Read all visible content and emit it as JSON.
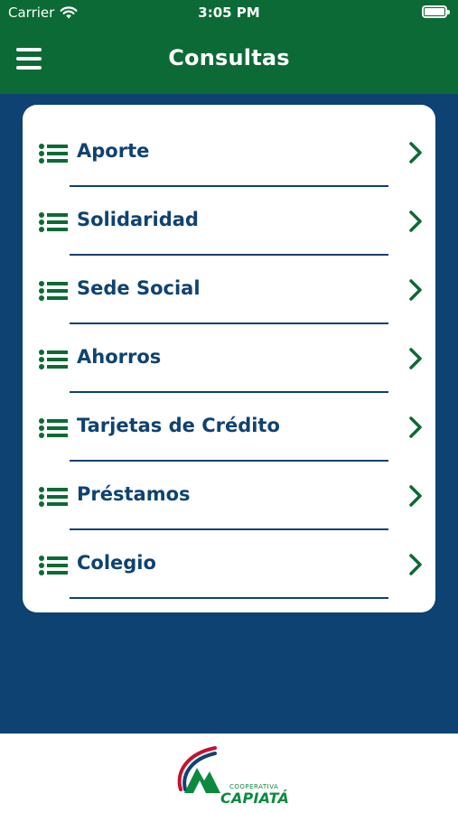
{
  "status_bar": {
    "carrier": "Carrier",
    "time": "3:05 PM",
    "wifi_icon": "wifi-icon",
    "battery_icon": "battery-icon"
  },
  "header": {
    "title": "Consultas",
    "menu_icon": "hamburger-menu-icon",
    "background_color": "#0b6a35"
  },
  "main": {
    "background_color": "#0e4272",
    "items": [
      {
        "label": "Aporte",
        "icon": "list-icon",
        "chevron": "chevron-right-icon"
      },
      {
        "label": "Solidaridad",
        "icon": "list-icon",
        "chevron": "chevron-right-icon"
      },
      {
        "label": "Sede Social",
        "icon": "list-icon",
        "chevron": "chevron-right-icon"
      },
      {
        "label": "Ahorros",
        "icon": "list-icon",
        "chevron": "chevron-right-icon"
      },
      {
        "label": "Tarjetas de Crédito",
        "icon": "list-icon",
        "chevron": "chevron-right-icon"
      },
      {
        "label": "Préstamos",
        "icon": "list-icon",
        "chevron": "chevron-right-icon"
      },
      {
        "label": "Colegio",
        "icon": "list-icon",
        "chevron": "chevron-right-icon"
      }
    ]
  },
  "footer": {
    "logo": {
      "small_text": "COOPERATIVA",
      "name": "CAPIATÁ"
    }
  },
  "colors": {
    "brand_green": "#0b6a35",
    "accent_green": "#0b8a3e",
    "navy": "#0e4272",
    "red": "#c8102e"
  }
}
